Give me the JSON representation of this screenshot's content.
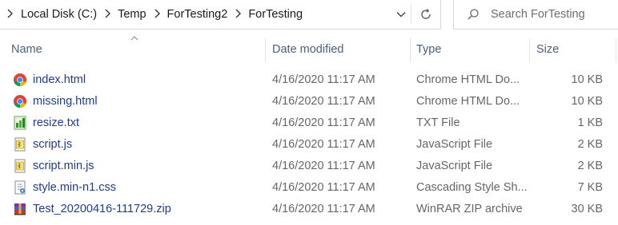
{
  "address": {
    "crumbs": [
      "Local Disk (C:)",
      "Temp",
      "ForTesting2",
      "ForTesting"
    ]
  },
  "search": {
    "placeholder": "Search ForTesting"
  },
  "columns": {
    "name": "Name",
    "date": "Date modified",
    "type": "Type",
    "size": "Size"
  },
  "files": [
    {
      "name": "index.html",
      "date": "4/16/2020 11:17 AM",
      "type": "Chrome HTML Do...",
      "size": "10 KB",
      "icon": "chrome-icon"
    },
    {
      "name": "missing.html",
      "date": "4/16/2020 11:17 AM",
      "type": "Chrome HTML Do...",
      "size": "10 KB",
      "icon": "chrome-icon"
    },
    {
      "name": "resize.txt",
      "date": "4/16/2020 11:17 AM",
      "type": "TXT File",
      "size": "1 KB",
      "icon": "text-file-icon"
    },
    {
      "name": "script.js",
      "date": "4/16/2020 11:17 AM",
      "type": "JavaScript File",
      "size": "2 KB",
      "icon": "javascript-file-icon"
    },
    {
      "name": "script.min.js",
      "date": "4/16/2020 11:17 AM",
      "type": "JavaScript File",
      "size": "2 KB",
      "icon": "javascript-file-icon"
    },
    {
      "name": "style.min-n1.css",
      "date": "4/16/2020 11:17 AM",
      "type": "Cascading Style Sh...",
      "size": "7 KB",
      "icon": "css-file-icon"
    },
    {
      "name": "Test_20200416-111729.zip",
      "date": "4/16/2020 11:17 AM",
      "type": "WinRAR ZIP archive",
      "size": "30 KB",
      "icon": "winrar-archive-icon"
    }
  ]
}
